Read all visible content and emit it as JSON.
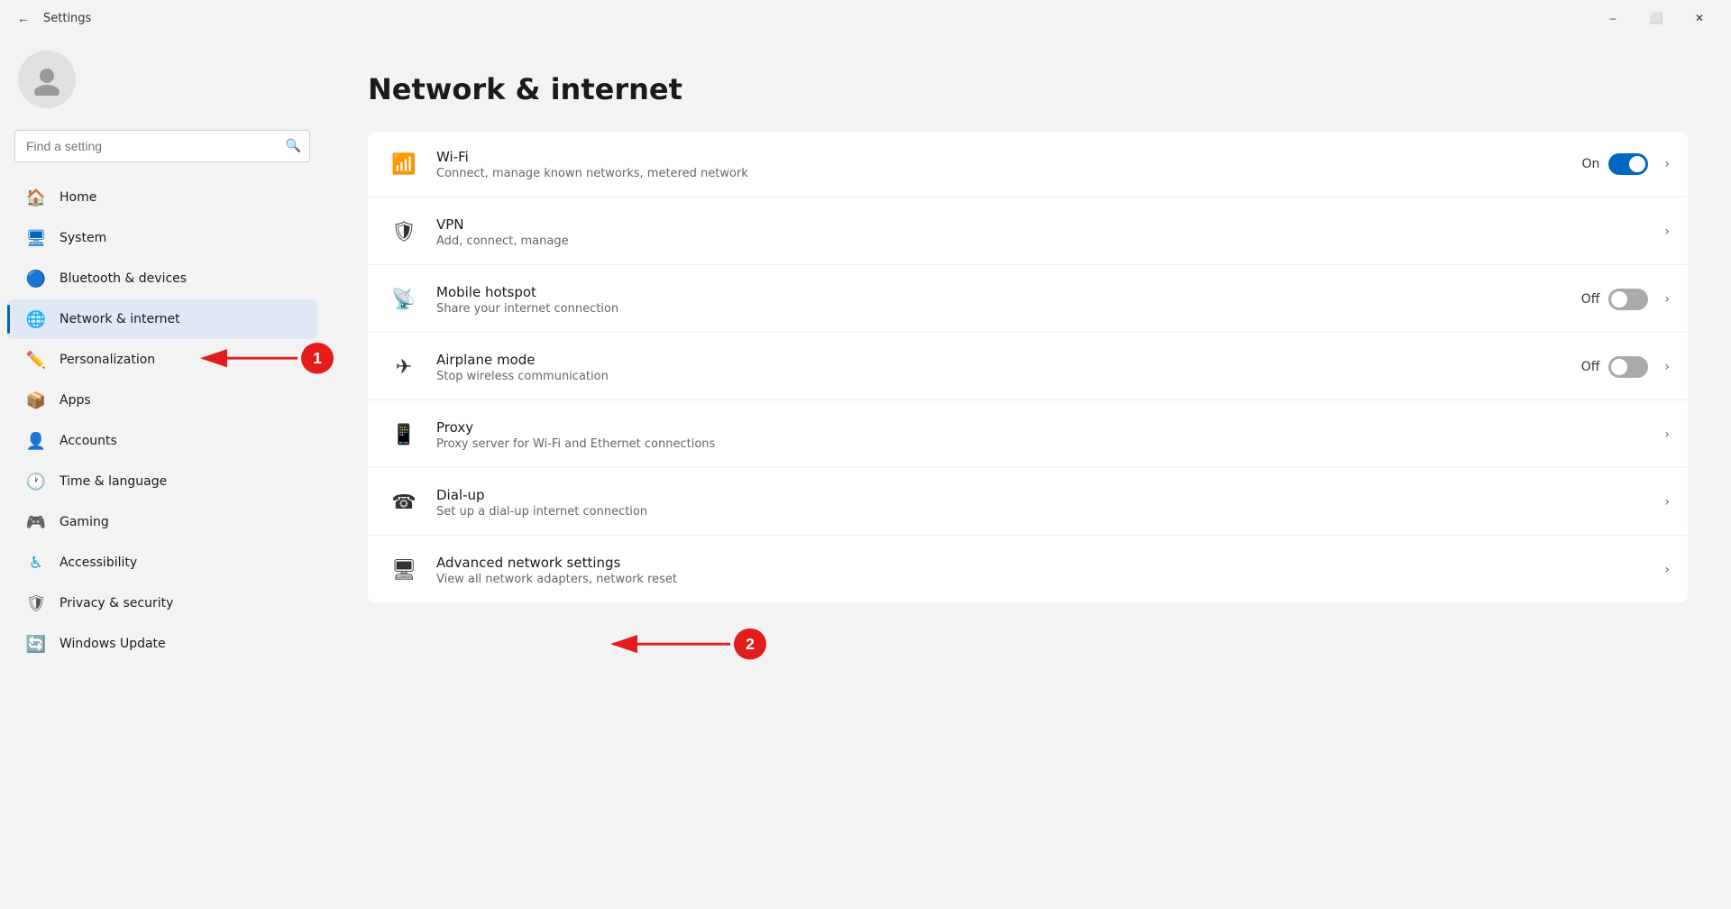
{
  "titlebar": {
    "back_label": "←",
    "title": "Settings",
    "minimize": "–",
    "maximize": "⬜",
    "close": "✕"
  },
  "sidebar": {
    "search_placeholder": "Find a setting",
    "nav_items": [
      {
        "id": "home",
        "icon": "🏠",
        "label": "Home",
        "active": false
      },
      {
        "id": "system",
        "icon": "🖥",
        "label": "System",
        "active": false
      },
      {
        "id": "bluetooth",
        "icon": "🔵",
        "label": "Bluetooth & devices",
        "active": false
      },
      {
        "id": "network",
        "icon": "🌐",
        "label": "Network & internet",
        "active": true
      },
      {
        "id": "personalization",
        "icon": "✏️",
        "label": "Personalization",
        "active": false
      },
      {
        "id": "apps",
        "icon": "📦",
        "label": "Apps",
        "active": false
      },
      {
        "id": "accounts",
        "icon": "👤",
        "label": "Accounts",
        "active": false
      },
      {
        "id": "time",
        "icon": "🕐",
        "label": "Time & language",
        "active": false
      },
      {
        "id": "gaming",
        "icon": "🎮",
        "label": "Gaming",
        "active": false
      },
      {
        "id": "accessibility",
        "icon": "♿",
        "label": "Accessibility",
        "active": false
      },
      {
        "id": "privacy",
        "icon": "🛡",
        "label": "Privacy & security",
        "active": false
      },
      {
        "id": "windows-update",
        "icon": "🔄",
        "label": "Windows Update",
        "active": false
      }
    ]
  },
  "content": {
    "page_title": "Network & internet",
    "settings": [
      {
        "id": "wifi",
        "name": "Wi-Fi",
        "desc": "Connect, manage known networks, metered network",
        "has_toggle": true,
        "toggle_state": "on",
        "toggle_label": "On",
        "has_chevron": true
      },
      {
        "id": "vpn",
        "name": "VPN",
        "desc": "Add, connect, manage",
        "has_toggle": false,
        "has_chevron": true
      },
      {
        "id": "mobile-hotspot",
        "name": "Mobile hotspot",
        "desc": "Share your internet connection",
        "has_toggle": true,
        "toggle_state": "off",
        "toggle_label": "Off",
        "has_chevron": true
      },
      {
        "id": "airplane-mode",
        "name": "Airplane mode",
        "desc": "Stop wireless communication",
        "has_toggle": true,
        "toggle_state": "off",
        "toggle_label": "Off",
        "has_chevron": true
      },
      {
        "id": "proxy",
        "name": "Proxy",
        "desc": "Proxy server for Wi-Fi and Ethernet connections",
        "has_toggle": false,
        "has_chevron": true
      },
      {
        "id": "dial-up",
        "name": "Dial-up",
        "desc": "Set up a dial-up internet connection",
        "has_toggle": false,
        "has_chevron": true
      },
      {
        "id": "advanced-network",
        "name": "Advanced network settings",
        "desc": "View all network adapters, network reset",
        "has_toggle": false,
        "has_chevron": true
      }
    ]
  },
  "icons": {
    "wifi": "📶",
    "vpn": "🛡",
    "hotspot": "📡",
    "airplane": "✈",
    "proxy": "📲",
    "dialup": "📞",
    "advanced": "🖥"
  },
  "annotations": [
    {
      "id": "1",
      "label": "1"
    },
    {
      "id": "2",
      "label": "2"
    }
  ]
}
